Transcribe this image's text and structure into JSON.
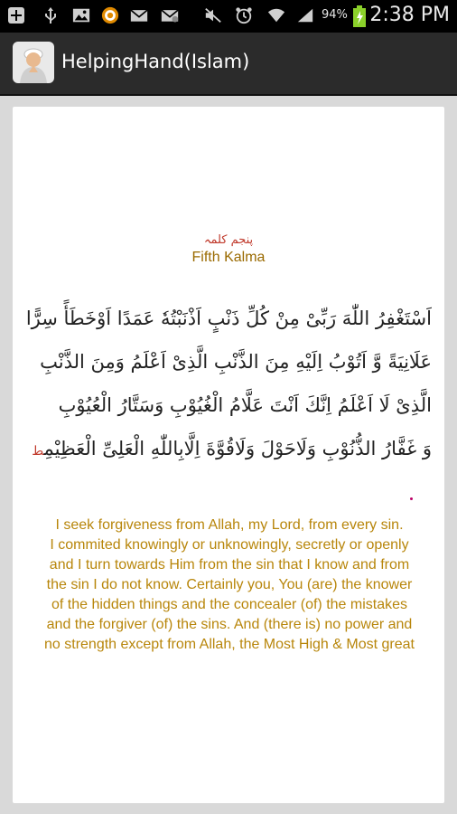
{
  "status_bar": {
    "battery_percent": "94%",
    "time": "2:38 PM",
    "icons": [
      "add-icon",
      "usb-icon",
      "image-icon",
      "app-icon",
      "mail-icon",
      "mail-alt-icon",
      "mute-icon",
      "alarm-icon",
      "wifi-icon",
      "signal-icon",
      "battery-icon"
    ]
  },
  "action_bar": {
    "title": "HelpingHand(Islam)"
  },
  "kalma": {
    "urdu_title": "پنجم کلمہ",
    "title": "Fifth Kalma",
    "arabic_lines": [
      "اَسْتَغْفِرُ اللّٰهَ رَبِّىْ مِنْ كُلِّ ذَنْبٍ اَذْنَبْتُهٗ عَمَدًا اَوْخَطَأً سِرًّا اَوْ",
      "عَلَانِيَةً وَّ اَتُوْبُ اِلَيْهِ مِنَ الذَّنْبِ الَّذِیْ اَعْلَمُ وَمِنَ الذَّنْبِ",
      "الَّذِیْ لَا اَعْلَمُ اِنَّكَ اَنْتَ عَلَّامُ الْغُيُوْبِ وَسَتَّارُ الْعُيُوْبِ",
      "وَ غَفَّارُ الذُّنُوْبِ وَلَاحَوْلَ وَلَاقُوَّةَ اِلَّابِاللّٰهِ الْعَلِیِّ الْعَظِيْمِ"
    ],
    "stop_mark": "ط",
    "english_lines": [
      "I seek forgiveness from Allah, my Lord, from every sin.",
      "I commited knowingly or unknowingly, secretly or openly",
      "and I turn towards Him from the sin that I know and from",
      "the sin I do not know. Certainly you, You (are) the knower",
      "of the hidden things and the concealer (of) the mistakes",
      "and the forgiver (of) the sins. And (there is) no power and",
      "no strength except from Allah, the Most High & Most great"
    ]
  }
}
